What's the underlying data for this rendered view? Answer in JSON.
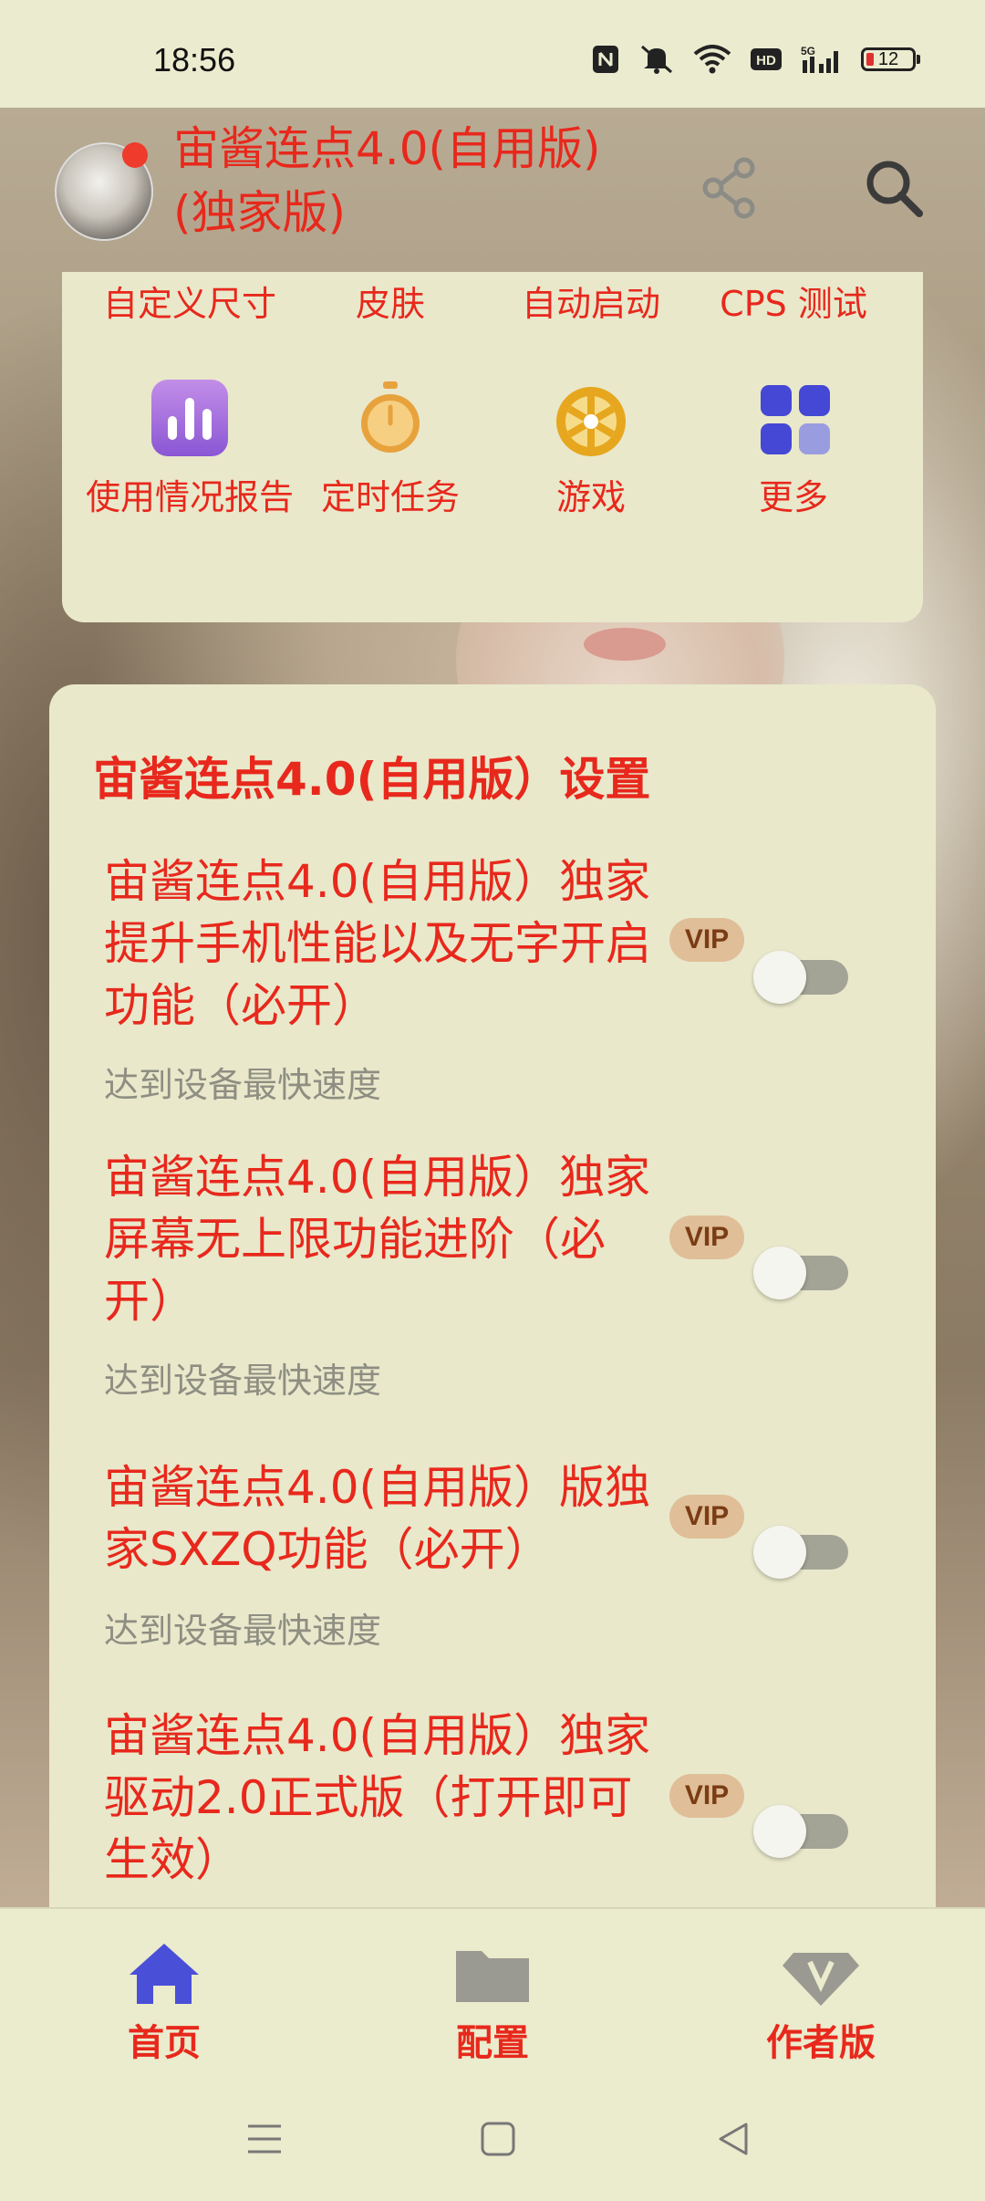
{
  "status_bar": {
    "time": "18:56",
    "battery": "12",
    "icons": [
      "nfc-icon",
      "mute-icon",
      "wifi-icon",
      "hd-icon",
      "signal-5g-icon",
      "battery-icon"
    ]
  },
  "header": {
    "title": "宙酱连点4.0(自用版)(独家版)",
    "icons": [
      "share-icon",
      "search-icon"
    ]
  },
  "grid": {
    "row1": [
      "自定义尺寸",
      "皮肤",
      "自动启动",
      "CPS 测试"
    ],
    "row2": [
      {
        "label": "使用情况报告",
        "icon": "bar-chart-icon"
      },
      {
        "label": "定时任务",
        "icon": "stopwatch-icon"
      },
      {
        "label": "游戏",
        "icon": "wheel-icon"
      },
      {
        "label": "更多",
        "icon": "more-grid-icon"
      }
    ]
  },
  "settings": {
    "title": "宙酱连点4.0(自用版）设置",
    "items": [
      {
        "title": "宙酱连点4.0(自用版）独家提升手机性能以及无字开启功能（必开）",
        "subtitle": "达到设备最快速度",
        "badge": "VIP",
        "enabled": false
      },
      {
        "title": "宙酱连点4.0(自用版）独家屏幕无上限功能进阶（必开）",
        "subtitle": "达到设备最快速度",
        "badge": "VIP",
        "enabled": false
      },
      {
        "title": "宙酱连点4.0(自用版）版独家SXZQ功能（必开）",
        "subtitle": "达到设备最快速度",
        "badge": "VIP",
        "enabled": false
      },
      {
        "title": "宙酱连点4.0(自用版）独家驱动2.0正式版（打开即可生效）",
        "subtitle": "",
        "badge": "VIP",
        "enabled": false
      }
    ]
  },
  "bottom_nav": [
    {
      "label": "首页",
      "icon": "home-icon",
      "active": true
    },
    {
      "label": "配置",
      "icon": "folder-icon",
      "active": false
    },
    {
      "label": "作者版",
      "icon": "vip-diamond-icon",
      "active": false
    }
  ],
  "colors": {
    "accent": "#e8281c",
    "nav_active": "#4a4fd8",
    "background": "#ebeacb"
  }
}
